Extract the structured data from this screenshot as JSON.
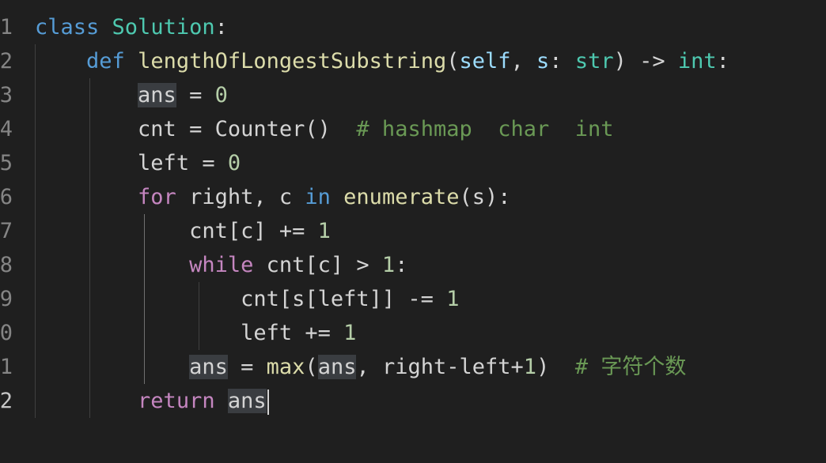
{
  "editor": {
    "background": "#1f1f1f",
    "language": "python",
    "current_line": 12,
    "lines": [
      {
        "num": "1",
        "tokens": [
          {
            "t": "class",
            "c": "kw-blue"
          },
          {
            "t": " ",
            "c": ""
          },
          {
            "t": "Solution",
            "c": "cls"
          },
          {
            "t": ":",
            "c": "op"
          }
        ]
      },
      {
        "num": "2",
        "tokens": [
          {
            "t": "    ",
            "c": ""
          },
          {
            "t": "def",
            "c": "kw-blue"
          },
          {
            "t": " ",
            "c": ""
          },
          {
            "t": "lengthOfLongestSubstring",
            "c": "fn"
          },
          {
            "t": "(",
            "c": "op"
          },
          {
            "t": "self",
            "c": "param"
          },
          {
            "t": ", ",
            "c": "op"
          },
          {
            "t": "s",
            "c": "param"
          },
          {
            "t": ": ",
            "c": "op"
          },
          {
            "t": "str",
            "c": "cls"
          },
          {
            "t": ") -> ",
            "c": "op"
          },
          {
            "t": "int",
            "c": "cls"
          },
          {
            "t": ":",
            "c": "op"
          }
        ]
      },
      {
        "num": "3",
        "tokens": [
          {
            "t": "        ",
            "c": ""
          },
          {
            "t": "ans",
            "c": "hl"
          },
          {
            "t": " = ",
            "c": "op"
          },
          {
            "t": "0",
            "c": "num"
          }
        ]
      },
      {
        "num": "4",
        "tokens": [
          {
            "t": "        ",
            "c": ""
          },
          {
            "t": "cnt = ",
            "c": "op"
          },
          {
            "t": "Counter",
            "c": "op"
          },
          {
            "t": "()  ",
            "c": "op"
          },
          {
            "t": "# hashmap  char  int",
            "c": "cmt"
          }
        ]
      },
      {
        "num": "5",
        "tokens": [
          {
            "t": "        ",
            "c": ""
          },
          {
            "t": "left = ",
            "c": "op"
          },
          {
            "t": "0",
            "c": "num"
          }
        ]
      },
      {
        "num": "6",
        "tokens": [
          {
            "t": "        ",
            "c": ""
          },
          {
            "t": "for",
            "c": "kw-ctrl"
          },
          {
            "t": " right, c ",
            "c": "op"
          },
          {
            "t": "in",
            "c": "kw-blue"
          },
          {
            "t": " ",
            "c": ""
          },
          {
            "t": "enumerate",
            "c": "fn"
          },
          {
            "t": "(s):",
            "c": "op"
          }
        ]
      },
      {
        "num": "7",
        "tokens": [
          {
            "t": "            ",
            "c": ""
          },
          {
            "t": "cnt[c] += ",
            "c": "op"
          },
          {
            "t": "1",
            "c": "num"
          }
        ]
      },
      {
        "num": "8",
        "tokens": [
          {
            "t": "            ",
            "c": ""
          },
          {
            "t": "while",
            "c": "kw-ctrl"
          },
          {
            "t": " cnt[c] > ",
            "c": "op"
          },
          {
            "t": "1",
            "c": "num"
          },
          {
            "t": ":",
            "c": "op"
          }
        ]
      },
      {
        "num": "9",
        "tokens": [
          {
            "t": "                ",
            "c": ""
          },
          {
            "t": "cnt[s[left]] -= ",
            "c": "op"
          },
          {
            "t": "1",
            "c": "num"
          }
        ]
      },
      {
        "num": "0",
        "tokens": [
          {
            "t": "                ",
            "c": ""
          },
          {
            "t": "left += ",
            "c": "op"
          },
          {
            "t": "1",
            "c": "num"
          }
        ]
      },
      {
        "num": "1",
        "tokens": [
          {
            "t": "            ",
            "c": ""
          },
          {
            "t": "ans",
            "c": "hl"
          },
          {
            "t": " = ",
            "c": "op"
          },
          {
            "t": "max",
            "c": "fn"
          },
          {
            "t": "(",
            "c": "op"
          },
          {
            "t": "ans",
            "c": "hl"
          },
          {
            "t": ", right-left+",
            "c": "op"
          },
          {
            "t": "1",
            "c": "num"
          },
          {
            "t": ")  ",
            "c": "op"
          },
          {
            "t": "# 字符个数",
            "c": "cmt"
          }
        ]
      },
      {
        "num": "2",
        "tokens": [
          {
            "t": "        ",
            "c": ""
          },
          {
            "t": "return",
            "c": "kw-ctrl"
          },
          {
            "t": " ",
            "c": ""
          },
          {
            "t": "ans",
            "c": "hl"
          }
        ]
      }
    ]
  }
}
